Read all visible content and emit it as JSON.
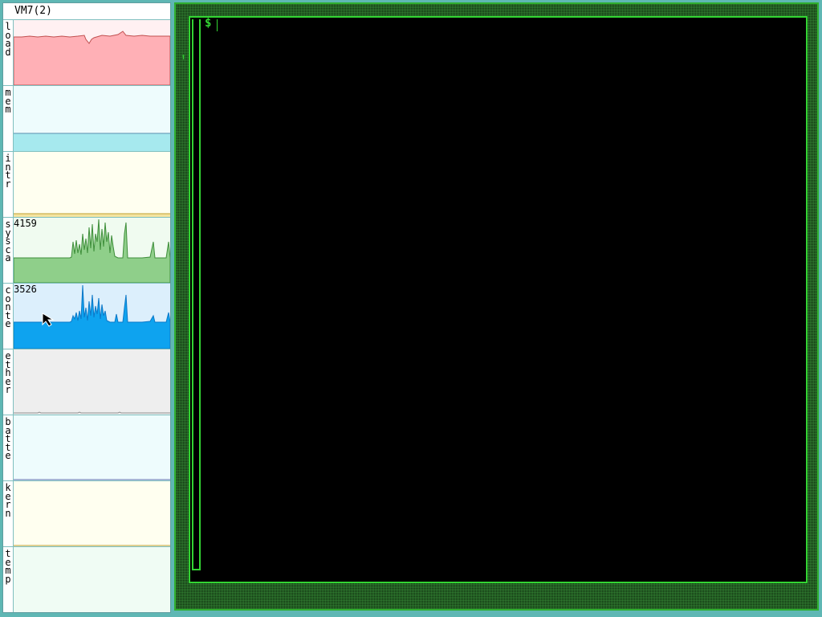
{
  "stats": {
    "title": "VM7(2)",
    "rows": [
      {
        "label": "load",
        "peak": "",
        "bg": "#fff0f2",
        "fill": "#ffb0b6",
        "line": "#c05050"
      },
      {
        "label": "mem",
        "peak": "",
        "bg": "#eefcfd",
        "fill": "#a6e9ee",
        "line": "#5a8fb0"
      },
      {
        "label": "intr",
        "peak": "",
        "bg": "#fffff0",
        "fill": "#f4e4a0",
        "line": "#c0a030"
      },
      {
        "label": "sysca",
        "peak": "4159",
        "bg": "#f0fbf0",
        "fill": "#8fcf8a",
        "line": "#3e8e3a"
      },
      {
        "label": "conte",
        "peak": "3526",
        "bg": "#dceffc",
        "fill": "#0ea3ef",
        "line": "#0b78c8"
      },
      {
        "label": "ether",
        "peak": "",
        "bg": "#eeeeee",
        "fill": "#cccccc",
        "line": "#909090"
      },
      {
        "label": "batte",
        "peak": "",
        "bg": "#eefcfd",
        "fill": "#a6e9ee",
        "line": "#6070b0"
      },
      {
        "label": "kern",
        "peak": "",
        "bg": "#fffff0",
        "fill": "#f4e4a0",
        "line": "#c0a030"
      },
      {
        "label": "temp",
        "peak": "",
        "bg": "#f0fcf4",
        "fill": "#b8ecc8",
        "line": "#60b080"
      }
    ]
  },
  "terminal": {
    "prompt": "$",
    "resize_mark": "↖",
    "border_color": "#33d433"
  },
  "pointer": {
    "icon": "mouse-pointer-icon"
  }
}
